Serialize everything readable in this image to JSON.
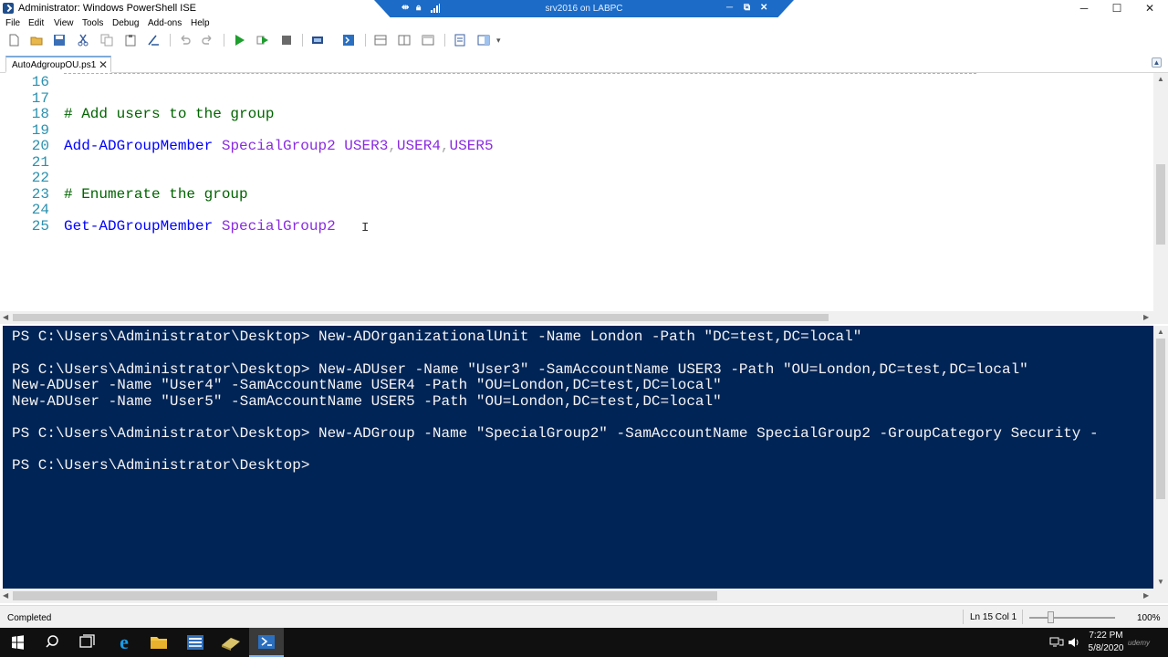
{
  "window": {
    "title": "Administrator: Windows PowerShell ISE",
    "minimize": "─",
    "maximize": "☐",
    "close": "✕"
  },
  "remote_bar": {
    "title": "srv2016 on LABPC",
    "minimize": "─",
    "restore": "⧉",
    "close": "✕"
  },
  "menu": {
    "items": [
      "File",
      "Edit",
      "View",
      "Tools",
      "Debug",
      "Add-ons",
      "Help"
    ]
  },
  "tab": {
    "label": "AutoAdgroupOU.ps1",
    "close": "✕"
  },
  "editor": {
    "line_numbers": [
      "16",
      "17",
      "18",
      "19",
      "20",
      "21",
      "22",
      "23",
      "24",
      "25"
    ],
    "line18_comment": "# Add users to the group",
    "line20_cmd": "Add-ADGroupMember",
    "line20_group": "SpecialGroup2",
    "line20_user3": "USER3",
    "line20_comma1": ",",
    "line20_user4": "USER4",
    "line20_comma2": ",",
    "line20_user5": "USER5",
    "line23_comment": "# Enumerate the group",
    "line25_cmd": "Get-ADGroupMember",
    "line25_group": "SpecialGroup2"
  },
  "console": {
    "lines": [
      "PS C:\\Users\\Administrator\\Desktop> New-ADOrganizationalUnit -Name London -Path \"DC=test,DC=local\"",
      "PS C:\\Users\\Administrator\\Desktop> New-ADUser -Name \"User3\" -SamAccountName USER3 -Path \"OU=London,DC=test,DC=local\"",
      "New-ADUser -Name \"User4\" -SamAccountName USER4 -Path \"OU=London,DC=test,DC=local\"",
      "New-ADUser -Name \"User5\" -SamAccountName USER5 -Path \"OU=London,DC=test,DC=local\"",
      "PS C:\\Users\\Administrator\\Desktop> New-ADGroup -Name \"SpecialGroup2\" -SamAccountName SpecialGroup2 -GroupCategory Security -",
      "PS C:\\Users\\Administrator\\Desktop>"
    ]
  },
  "status": {
    "text": "Completed",
    "cursor": "Ln 15  Col 1",
    "zoom": "100%",
    "zoom_fraction": 0.25
  },
  "taskbar": {
    "time": "7:22 PM",
    "date": "5/8/2020",
    "watermark": "udemy"
  },
  "colors": {
    "console_bg": "#012456",
    "comment": "#006400",
    "command": "#0000ff",
    "argument": "#8a2be2",
    "line_number": "#2b91af",
    "remote_bar": "#1b6bc7"
  }
}
